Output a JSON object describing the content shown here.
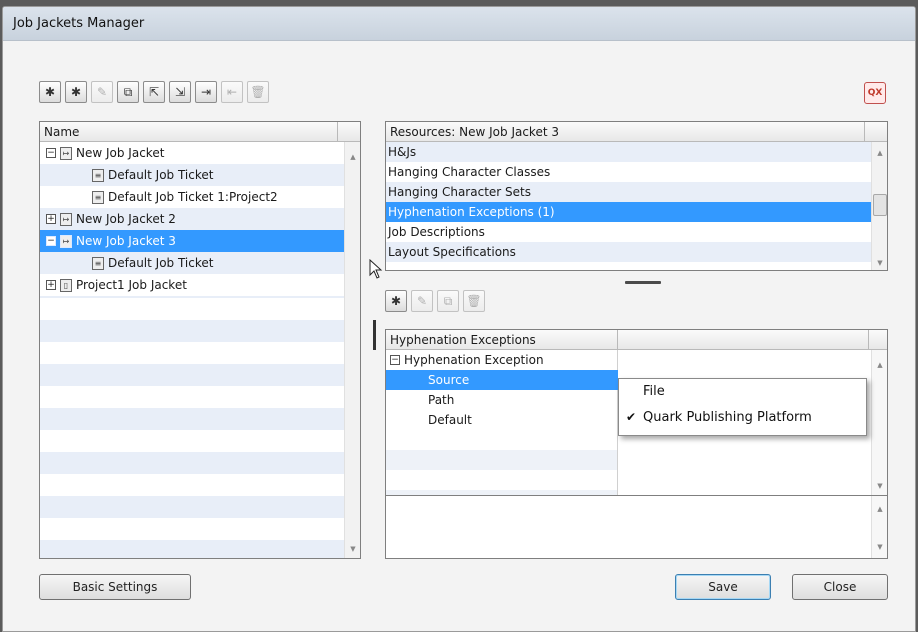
{
  "window": {
    "title": "Job Jackets Manager"
  },
  "left_toolbar": [
    {
      "name": "new-job-jacket-icon",
      "glyph": "✱",
      "enabled": true
    },
    {
      "name": "new-job-ticket-icon",
      "glyph": "✱",
      "enabled": true
    },
    {
      "name": "edit-icon",
      "glyph": "✎",
      "enabled": false
    },
    {
      "name": "duplicate-icon",
      "glyph": "⧉",
      "enabled": true
    },
    {
      "name": "open-icon",
      "glyph": "⇱",
      "enabled": true
    },
    {
      "name": "save-icon",
      "glyph": "⇲",
      "enabled": true
    },
    {
      "name": "import-icon",
      "glyph": "⇥",
      "enabled": true
    },
    {
      "name": "export-icon",
      "glyph": "⇤",
      "enabled": false
    },
    {
      "name": "delete-icon",
      "glyph": "🗑",
      "enabled": false
    }
  ],
  "right_toolbar": [
    {
      "name": "new-item-icon",
      "glyph": "✱",
      "enabled": true
    },
    {
      "name": "edit-icon",
      "glyph": "✎",
      "enabled": false
    },
    {
      "name": "duplicate-icon",
      "glyph": "⧉",
      "enabled": false
    },
    {
      "name": "delete-icon",
      "glyph": "🗑",
      "enabled": false
    }
  ],
  "logo": {
    "text": "QX"
  },
  "tree": {
    "header": "Name",
    "items": [
      {
        "label": "New Job Jacket",
        "indent": 0,
        "expander": "−",
        "icon": "↦"
      },
      {
        "label": "Default Job Ticket",
        "indent": 1,
        "expander": "",
        "icon": "≡"
      },
      {
        "label": "Default Job Ticket 1:Project2",
        "indent": 1,
        "expander": "",
        "icon": "≡"
      },
      {
        "label": "New Job Jacket 2",
        "indent": 0,
        "expander": "+",
        "icon": "↦"
      },
      {
        "label": "New Job Jacket 3",
        "indent": 0,
        "expander": "−",
        "icon": "↦",
        "selected": true
      },
      {
        "label": "Default Job Ticket",
        "indent": 1,
        "expander": "",
        "icon": "≡"
      },
      {
        "label": "Project1 Job Jacket",
        "indent": 0,
        "expander": "+",
        "icon": "▯"
      }
    ]
  },
  "resources": {
    "header": "Resources: New Job Jacket 3",
    "items": [
      {
        "label": "H&Js"
      },
      {
        "label": "Hanging Character Classes"
      },
      {
        "label": "Hanging Character Sets"
      },
      {
        "label": "Hyphenation Exceptions (1)",
        "selected": true
      },
      {
        "label": "Job Descriptions"
      },
      {
        "label": "Layout Specifications"
      }
    ]
  },
  "details": {
    "header": "Hyphenation Exceptions",
    "group": {
      "expander": "−",
      "label": "Hyphenation Exception"
    },
    "rows": [
      {
        "label": "Source",
        "selected": true
      },
      {
        "label": "Path"
      },
      {
        "label": "Default"
      }
    ]
  },
  "source_menu": {
    "options": [
      {
        "label": "File",
        "checked": false
      },
      {
        "label": "Quark Publishing Platform",
        "checked": true
      }
    ],
    "check_glyph": "✔"
  },
  "buttons": {
    "basic_settings": "Basic Settings",
    "save": "Save",
    "close": "Close"
  },
  "scroll_glyphs": {
    "up": "▲",
    "down": "▼"
  }
}
